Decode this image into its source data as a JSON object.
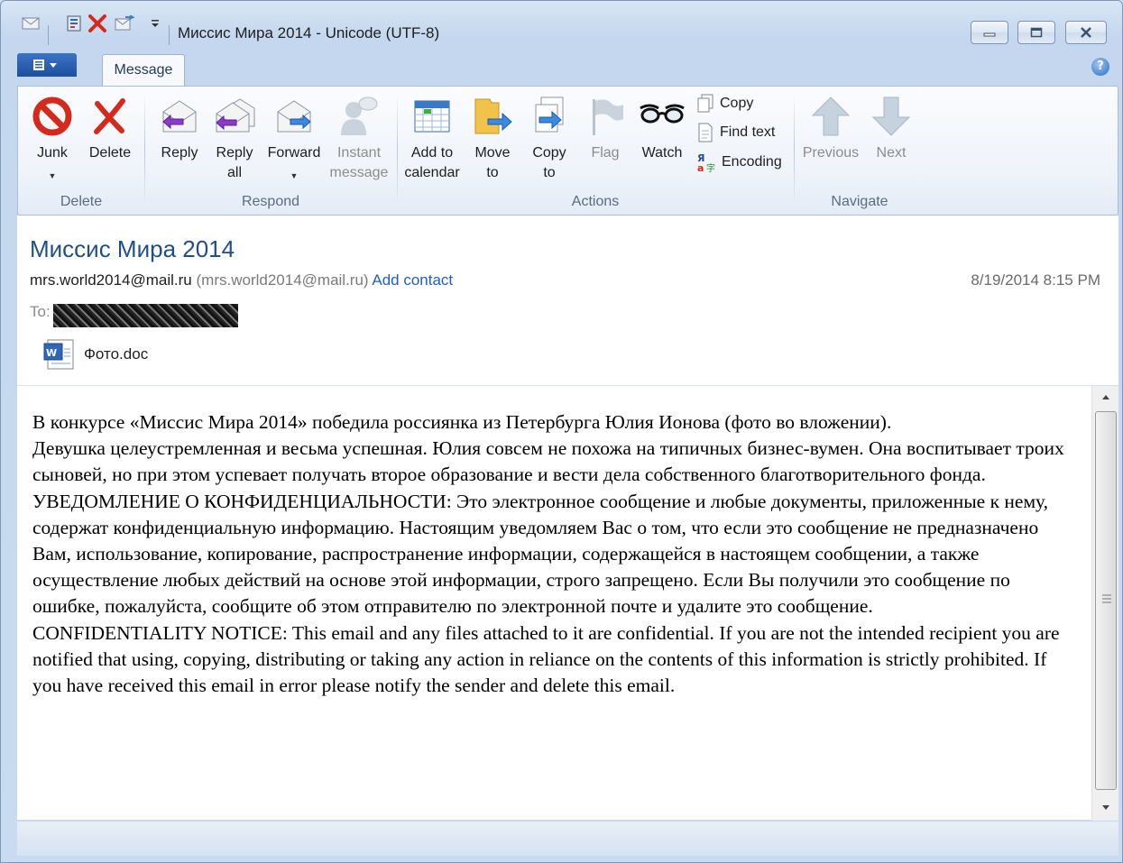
{
  "window": {
    "title": "Миссис Мира 2014 - Unicode (UTF-8)"
  },
  "tabs": {
    "message": "Message"
  },
  "ribbon": {
    "groups": {
      "delete": "Delete",
      "respond": "Respond",
      "actions": "Actions",
      "navigate": "Navigate"
    },
    "junk": "Junk",
    "delete": "Delete",
    "reply": "Reply",
    "reply_all_1": "Reply",
    "reply_all_2": "all",
    "forward": "Forward",
    "instant_1": "Instant",
    "instant_2": "message",
    "calendar_1": "Add to",
    "calendar_2": "calendar",
    "move_1": "Move",
    "move_2": "to",
    "copyto_1": "Copy",
    "copyto_2": "to",
    "flag": "Flag",
    "watch": "Watch",
    "copy": "Copy",
    "find_text": "Find text",
    "encoding": "Encoding",
    "previous": "Previous",
    "next": "Next"
  },
  "message": {
    "subject": "Миссис Мира 2014",
    "from_name": "mrs.world2014@mail.ru",
    "from_address": "(mrs.world2014@mail.ru)",
    "add_contact": "Add contact",
    "date": "8/19/2014 8:15 PM",
    "to_label": "To:",
    "attachment": "Фото.doc",
    "body": [
      "В конкурсе «Миссис Мира 2014» победила россиянка из Петербурга Юлия Ионова (фото во вложении).",
      "Девушка целеустремленная и весьма успешная. Юлия совсем не похожа на типичных бизнес-вумен. Она воспитывает троих сыновей, но при этом успевает получать второе образование и вести дела собственного благотворительного фонда.",
      "УВЕДОМЛЕНИЕ О КОНФИДЕНЦИАЛЬНОСТИ: Это электронное сообщение и любые документы, приложенные к нему, содержат конфиденциальную информацию. Настоящим уведомляем Вас о том, что если это сообщение не предназначено Вам, использование, копирование, распространение информации, содержащейся в настоящем сообщении, а также осуществление любых действий на основе этой информации, строго запрещено. Если Вы получили это сообщение по ошибке, пожалуйста, сообщите об этом отправителю по электронной почте и удалите это сообщение.",
      "CONFIDENTIALITY NOTICE: This email and any files attached to it are confidential. If you are not the intended recipient you are notified that using, copying, distributing or taking any action in reliance on the contents of this information is strictly prohibited. If you have received this email in error please notify the sender and delete this email."
    ]
  },
  "colors": {
    "accent": "#1f4e8c",
    "link": "#1f5fbf",
    "junk_red": "#d42a1e"
  }
}
